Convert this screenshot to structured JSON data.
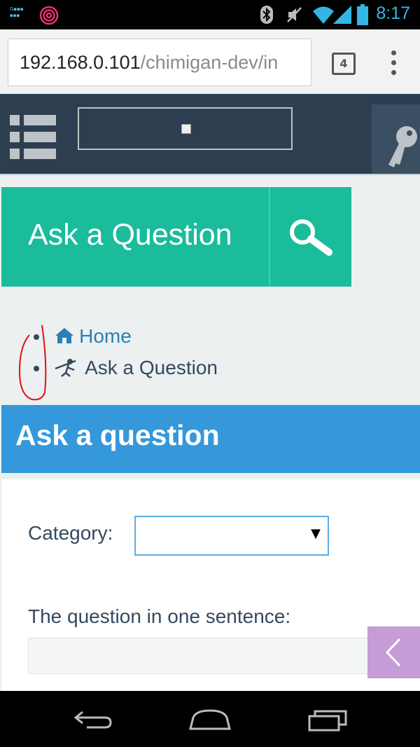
{
  "status_bar": {
    "time": "8:17",
    "icons": [
      "app-notification-icon",
      "fingerprint-icon",
      "bluetooth-icon",
      "mute-icon",
      "wifi-icon",
      "signal-icon",
      "battery-icon"
    ]
  },
  "browser": {
    "url_host": "192.168.0.101",
    "url_path": "/chimigan-dev/in",
    "tab_count": "4"
  },
  "header": {
    "menu_icon": "menu-icon",
    "login_icon": "key-icon"
  },
  "banner": {
    "label": "Ask a Question",
    "search_icon": "search-icon"
  },
  "breadcrumb": {
    "items": [
      {
        "label": "Home",
        "icon": "home-icon"
      },
      {
        "label": "Ask a Question",
        "icon": "question-figure-icon"
      }
    ]
  },
  "page": {
    "heading": "Ask a question"
  },
  "form": {
    "category_label": "Category:",
    "category_value": "",
    "question_label": "The question in one sentence:",
    "question_value": ""
  },
  "colors": {
    "header_bg": "#2c3e50",
    "banner_bg": "#1abc9c",
    "heading_bg": "#3498db",
    "link": "#2980b9",
    "side_tab": "#c59cd6"
  }
}
